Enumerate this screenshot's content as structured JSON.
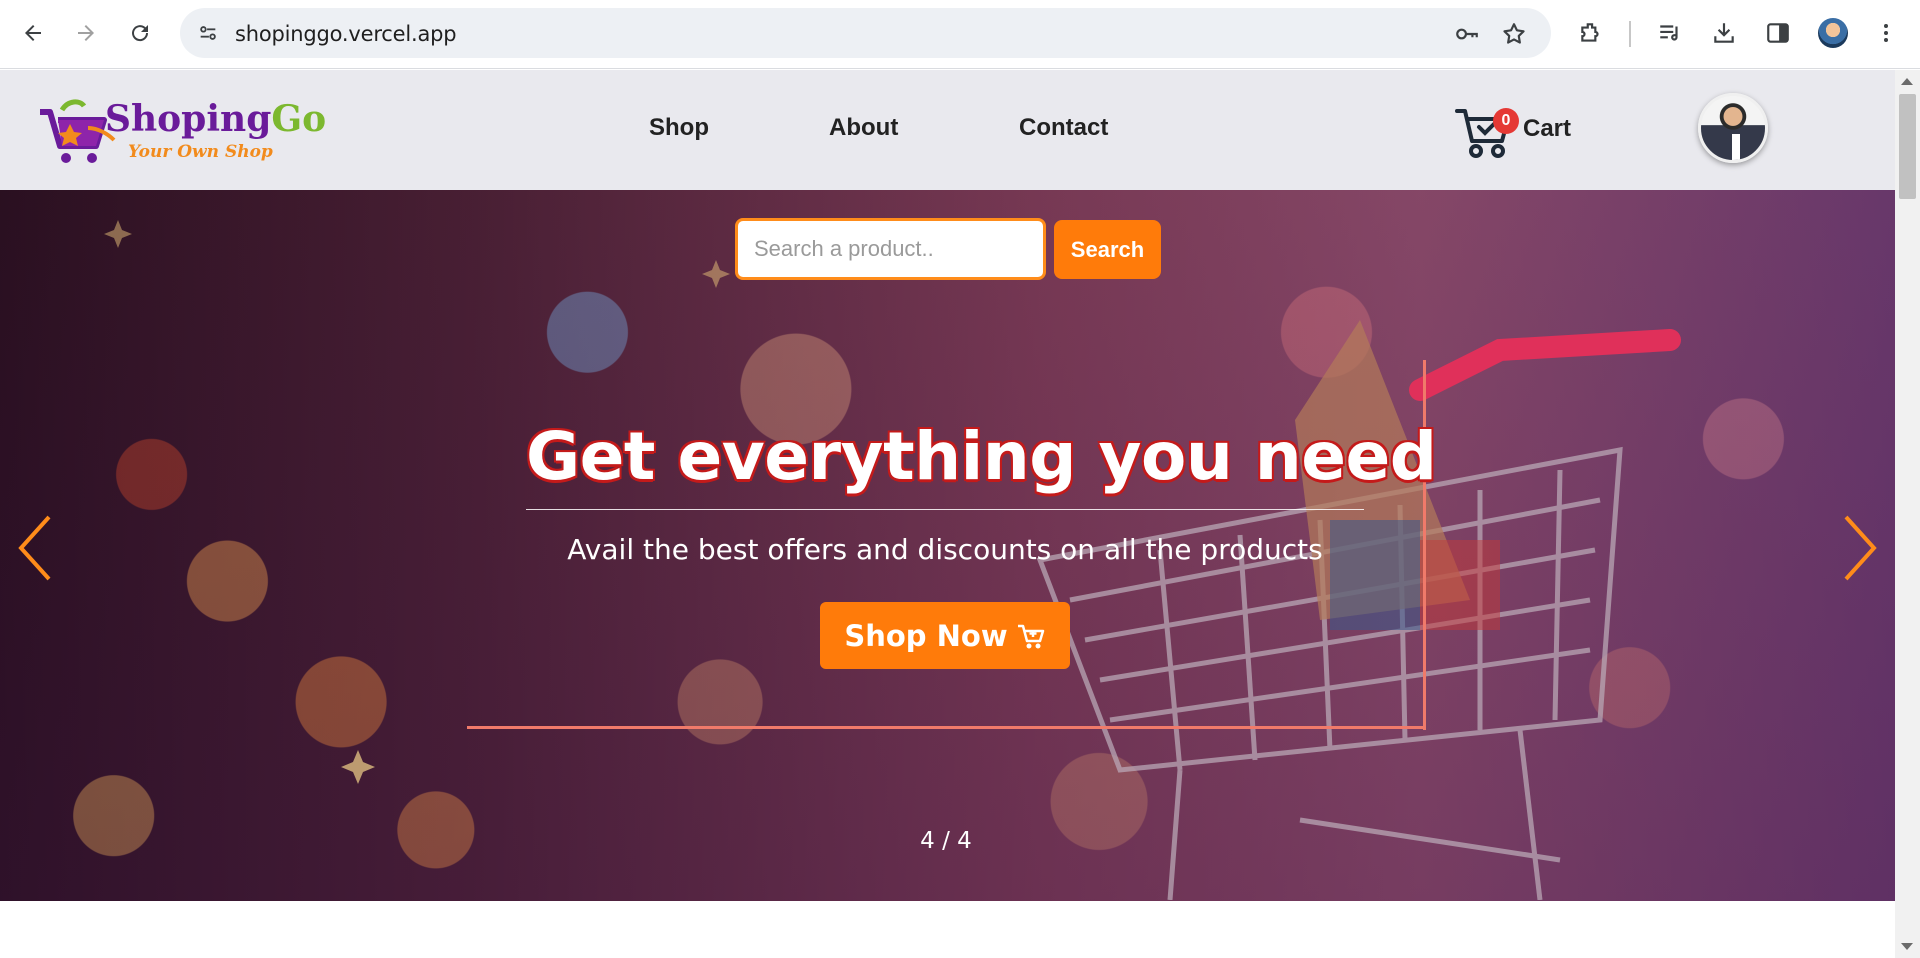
{
  "browser": {
    "url": "shopinggo.vercel.app",
    "icons": [
      "back-arrow-icon",
      "forward-arrow-icon",
      "reload-icon",
      "site-info-icon",
      "password-key-icon",
      "bookmark-star-icon",
      "extensions-icon",
      "media-queue-icon",
      "download-icon",
      "side-panel-icon",
      "profile-avatar",
      "more-menu-icon"
    ]
  },
  "header": {
    "logo": {
      "name_part1": "Shoping",
      "name_part2": "Go",
      "tagline": "Your Own Shop"
    },
    "nav": [
      {
        "label": "Shop"
      },
      {
        "label": "About"
      },
      {
        "label": "Contact"
      }
    ],
    "cart": {
      "label": "Cart",
      "count": "0"
    }
  },
  "hero": {
    "search": {
      "placeholder": "Search a product..",
      "button_label": "Search"
    },
    "title": "Get everything you need",
    "subtitle": "Avail the best offers and discounts on all the products",
    "cta_label": "Shop Now",
    "slide_counter": "4 / 4",
    "colors": {
      "accent": "#ff7b0a",
      "title_outline": "#c41a1a",
      "frame_line": "#f07a6a"
    }
  }
}
